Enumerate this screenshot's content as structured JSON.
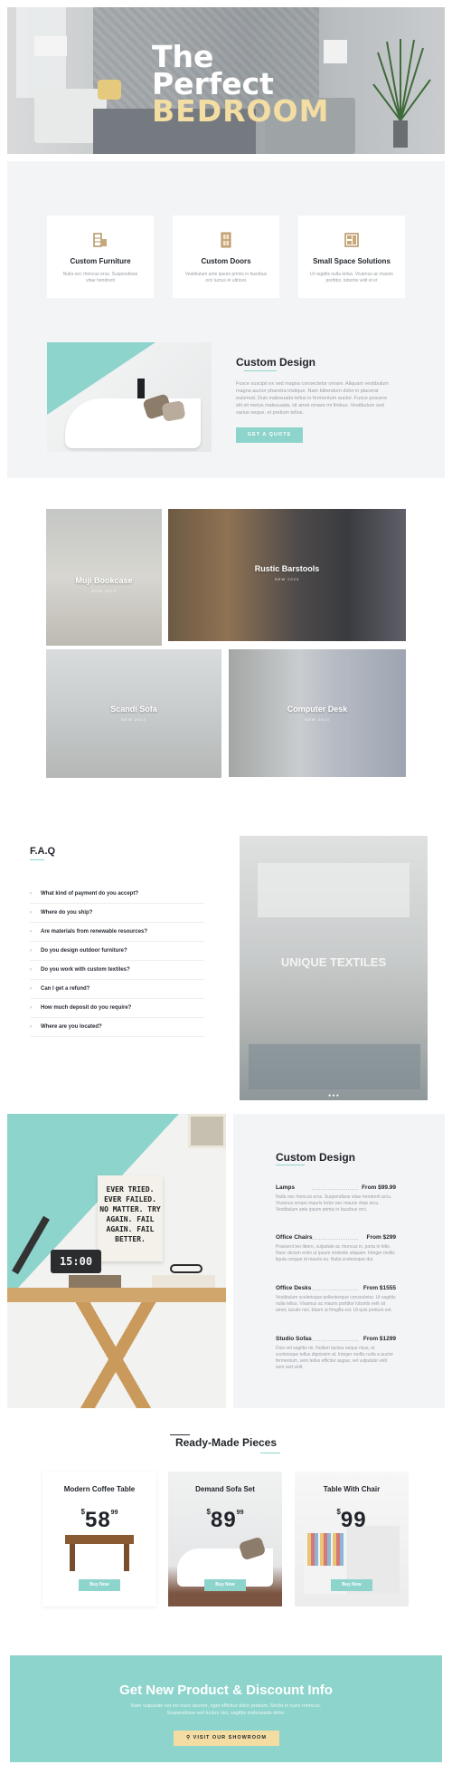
{
  "hero": {
    "title_line1": "The",
    "title_line2": "Perfect",
    "title_line3": "BEDROOM"
  },
  "services": [
    {
      "icon": "furniture-icon",
      "title": "Custom Furniture",
      "desc": "Nulla nec rhoncus eros. Suspendisse vitae hendrerit"
    },
    {
      "icon": "door-icon",
      "title": "Custom Doors",
      "desc": "Vestibulum ante ipsum primis in faucibus orci luctus et ultrices"
    },
    {
      "icon": "space-solution-icon",
      "title": "Small Space Solutions",
      "desc": "Ut sagittis nulla tellus. Vivamus ac mauris porttitor, lobortis velit et et"
    }
  ],
  "custom_design": {
    "title": "Custom Design",
    "body": "Fusce suscipit ex sed magna consectetur ornare. Aliquam vestibulum magna auctor pharetra tristique. Nam bibendum dolor in placerat euismod. Duis malesuada tellus in fermentum auctor. Fusce posuere elit sit metus malesuada, sit amet ornare mi finibus. Vestibulum sed varius neque, et pretium tellus.",
    "button": "GET A QUOTE"
  },
  "gallery": [
    {
      "label": "Muji Bookcase",
      "sub": "NEW 2023"
    },
    {
      "label": "Rustic Barstools",
      "sub": "NEW 2023"
    },
    {
      "label": "Scandi Sofa",
      "sub": "NEW 2023"
    },
    {
      "label": "Computer Desk",
      "sub": "NEW 2023"
    }
  ],
  "faq": {
    "title": "F.A.Q",
    "items": [
      "What kind of payment do you accept?",
      "Where do you ship?",
      "Are materials from renewable resources?",
      "Do you design outdoor furniture?",
      "Do you work with custom textiles?",
      "Can I get a refund?",
      "How much deposit do you require?",
      "Where are you located?"
    ],
    "image_brand": "UNIQUE TEXTILES",
    "carousel_dots": "● ● ●"
  },
  "poster_text": "EVER TRIED. EVER FAILED. NO MATTER. TRY AGAIN. FAIL AGAIN. FAIL BETTER.",
  "clock_text": "15:00",
  "menu": {
    "title": "Custom Design",
    "items": [
      {
        "name": "Lamps",
        "price": "From $99.99",
        "desc": "Nulla nec rhoncus eros. Suspendisse vitae hendrerit arcu. Vivamus ornare mauris tortor nec mauris vitae arcu. Vestibulum ante ipsum primis in faucibus orci."
      },
      {
        "name": "Office Chairs",
        "price": "From $299",
        "desc": "Praesent leo libero, vulputate ac rhoncus in, porta in felis. Nunc dictum enim ut ipsum molestie aliquam. Integer mollis ligula congue id mauris eu. Nulla scelerisque dui."
      },
      {
        "name": "Office Desks",
        "price": "From $1555",
        "desc": "Vestibulum scelerisque pellentesque consectetur. Ut sagittis nulla tellus. Vivamus ac mauris porttitor lobortis velit sit amet, iaculis nisi. Etiam ut fringilla est. Ut quis pretium est."
      },
      {
        "name": "Studio Sofas",
        "price": "From $1299",
        "desc": "Duis vel sagittis mi. Nullam lacinia neque risus, et scelerisque tellus dignissim at. Integer mollis nulla a auctor fermentum, sem tellus efficitur augue, vel vulputate velit sem sed velit."
      }
    ]
  },
  "ready_made": {
    "title": "Ready-Made Pieces",
    "products": [
      {
        "name": "Modern Coffee Table",
        "currency": "$",
        "price": "58",
        "cents": "99",
        "button": "Buy Now"
      },
      {
        "name": "Demand Sofa Set",
        "currency": "$",
        "price": "89",
        "cents": "99",
        "button": "Buy Now"
      },
      {
        "name": "Table With Chair",
        "currency": "$",
        "price": "99",
        "cents": "",
        "button": "Buy Now"
      }
    ]
  },
  "cta": {
    "title": "Get New Product & Discount Info",
    "body": "Nam vulputate est vel nunc laoreet, eget efficitur dolor pretium. Morbi et nunc rhoncus. Suspendisse sed luctus nisi, sagittis malesuada dolor.",
    "button": "VISIT OUR SHOWROOM"
  },
  "colors": {
    "accent": "#8dd4cc",
    "highlight": "#f3dda2",
    "section_bg": "#f3f4f6",
    "text_dark": "#1f2329"
  }
}
